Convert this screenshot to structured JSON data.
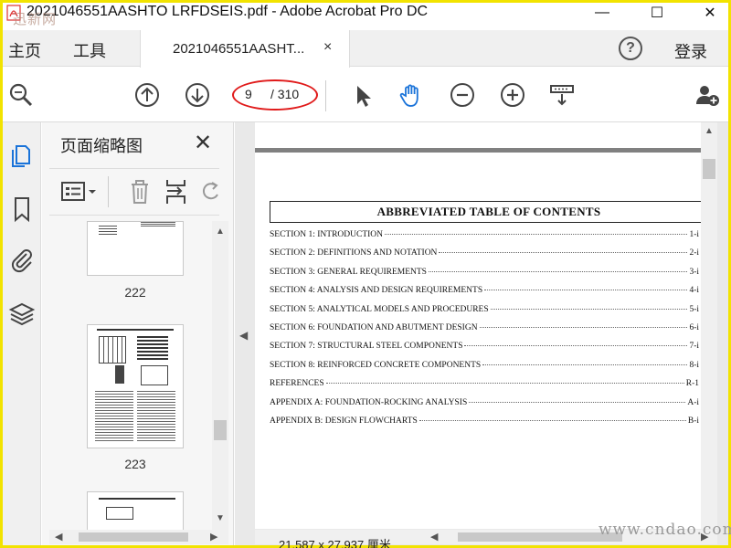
{
  "window": {
    "title": "2021046551AASHTO LRFDSEIS.pdf - Adobe Acrobat Pro DC",
    "minimize": "—",
    "maximize": "☐",
    "close": "✕"
  },
  "watermarks": {
    "top_left": "迅新网",
    "bottom_right": "www.cndao.com"
  },
  "menubar": {
    "home": "主页",
    "tools": "工具",
    "tab_label": "2021046551AASHT...",
    "tab_close": "×",
    "help": "?",
    "login": "登录"
  },
  "toolbar": {
    "page_current": "9",
    "page_total": "/ 310",
    "icons": [
      "search-zoom-icon",
      "page-up-icon",
      "page-down-icon",
      "select-cursor-icon",
      "hand-tool-icon",
      "zoom-out-icon",
      "zoom-in-icon",
      "scroll-mode-icon",
      "add-user-icon"
    ]
  },
  "navstrip": {
    "icons": [
      "page-thumbnails-icon",
      "bookmark-icon",
      "attachment-icon",
      "layers-icon"
    ]
  },
  "thumbnails_panel": {
    "title": "页面缩略图",
    "close": "✕",
    "pages": [
      "222",
      "223"
    ]
  },
  "document": {
    "toc_heading": "ABBREVIATED TABLE OF CONTENTS",
    "entries": [
      {
        "title": "SECTION 1: INTRODUCTION",
        "page": "1-i"
      },
      {
        "title": "SECTION 2: DEFINITIONS AND NOTATION",
        "page": "2-i"
      },
      {
        "title": "SECTION 3: GENERAL REQUIREMENTS",
        "page": "3-i"
      },
      {
        "title": "SECTION 4: ANALYSIS AND DESIGN REQUIREMENTS",
        "page": "4-i"
      },
      {
        "title": "SECTION 5: ANALYTICAL MODELS AND PROCEDURES",
        "page": "5-i"
      },
      {
        "title": "SECTION 6: FOUNDATION AND ABUTMENT DESIGN",
        "page": "6-i"
      },
      {
        "title": "SECTION 7: STRUCTURAL STEEL COMPONENTS",
        "page": "7-i"
      },
      {
        "title": "SECTION 8: REINFORCED CONCRETE COMPONENTS",
        "page": "8-i"
      },
      {
        "title": "REFERENCES",
        "page": "R-1"
      },
      {
        "title": "APPENDIX A: FOUNDATION-ROCKING ANALYSIS",
        "page": "A-i"
      },
      {
        "title": "APPENDIX B: DESIGN FLOWCHARTS",
        "page": "B-i"
      }
    ],
    "page_size": "21.587 x 27.937 厘米"
  },
  "colors": {
    "frame": "#f2e300",
    "highlight_ellipse": "#e01a1a",
    "accent_blue": "#1a73d9"
  }
}
